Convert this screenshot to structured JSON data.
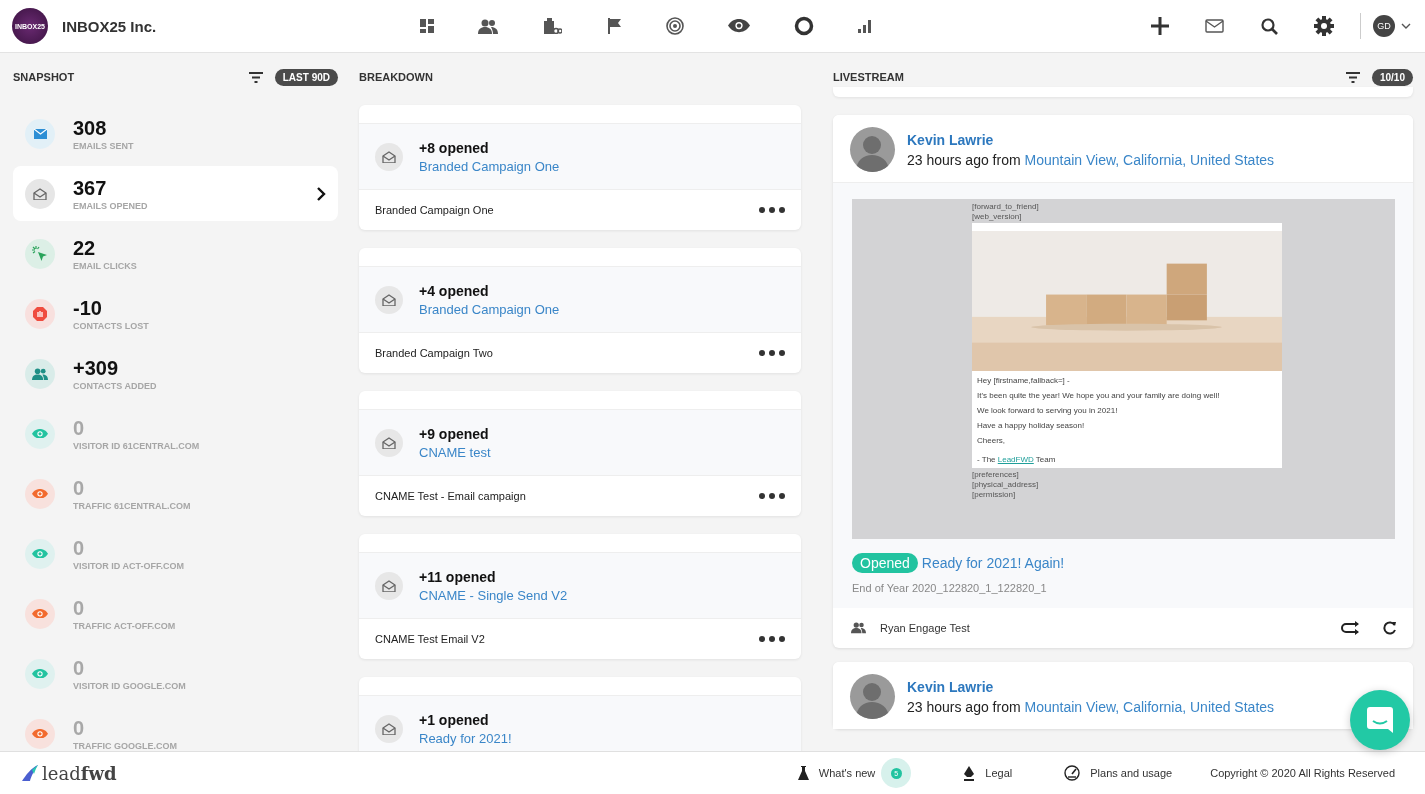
{
  "app": {
    "logo_text": "INBOX25",
    "company": "INBOX25 Inc.",
    "user_initials": "GD"
  },
  "snapshot": {
    "title": "SNAPSHOT",
    "badge": "LAST 90D",
    "stats": [
      {
        "kind": "sent",
        "value": "308",
        "label": "EMAILS SENT",
        "selected": false,
        "dimmed": false
      },
      {
        "kind": "opened",
        "value": "367",
        "label": "EMAILS OPENED",
        "selected": true,
        "dimmed": false
      },
      {
        "kind": "clicks",
        "value": "22",
        "label": "EMAIL CLICKS",
        "selected": false,
        "dimmed": false
      },
      {
        "kind": "lost",
        "value": "-10",
        "label": "CONTACTS LOST",
        "selected": false,
        "dimmed": false
      },
      {
        "kind": "added",
        "value": "+309",
        "label": "CONTACTS ADDED",
        "selected": false,
        "dimmed": false
      },
      {
        "kind": "visitor",
        "value": "0",
        "label": "VISITOR ID 61CENTRAL.COM",
        "selected": false,
        "dimmed": true
      },
      {
        "kind": "traffic",
        "value": "0",
        "label": "TRAFFIC 61CENTRAL.COM",
        "selected": false,
        "dimmed": true
      },
      {
        "kind": "visitor",
        "value": "0",
        "label": "VISITOR ID ACT-OFF.COM",
        "selected": false,
        "dimmed": true
      },
      {
        "kind": "traffic",
        "value": "0",
        "label": "TRAFFIC ACT-OFF.COM",
        "selected": false,
        "dimmed": true
      },
      {
        "kind": "visitor",
        "value": "0",
        "label": "VISITOR ID GOOGLE.COM",
        "selected": false,
        "dimmed": true
      },
      {
        "kind": "traffic",
        "value": "0",
        "label": "TRAFFIC GOOGLE.COM",
        "selected": false,
        "dimmed": true
      }
    ]
  },
  "breakdown": {
    "title": "BREAKDOWN",
    "cards": [
      {
        "count": "+8 opened",
        "campaign": "Branded Campaign One",
        "name": "Branded Campaign One"
      },
      {
        "count": "+4 opened",
        "campaign": "Branded Campaign One",
        "name": "Branded Campaign Two"
      },
      {
        "count": "+9 opened",
        "campaign": "CNAME test",
        "name": "CNAME Test - Email campaign"
      },
      {
        "count": "+11 opened",
        "campaign": "CNAME - Single Send V2",
        "name": "CNAME Test Email V2"
      },
      {
        "count": "+1 opened",
        "campaign": "Ready for 2021!"
      }
    ]
  },
  "livestream": {
    "title": "LIVESTREAM",
    "badge": "10/10",
    "events": [
      {
        "name": "Kevin Lawrie",
        "time": "23 hours ago from",
        "location": "Mountain View, California, United States",
        "preview": {
          "header_lines": [
            "[forward_to_friend]",
            "[web_version]"
          ],
          "body_lines": [
            "Hey [firstname,fallback=] -",
            "It's been quite the year! We hope you and your family are doing well!",
            "We look forward to serving you in 2021!",
            "Have a happy holiday season!",
            "Cheers,"
          ],
          "sign_prefix": "- The",
          "sign_link": "LeadFWD",
          "sign_suffix": "Team",
          "footer_lines": [
            "[preferences]",
            "[physical_address]",
            "[permission]"
          ]
        },
        "status": "Opened",
        "subject": "Ready for 2021! Again!",
        "campaign_id": "End of Year 2020_122820_1_122820_1",
        "list": "Ryan Engage Test"
      },
      {
        "name": "Kevin Lawrie",
        "time": "23 hours ago from",
        "location": "Mountain View, California, United States"
      }
    ]
  },
  "footer": {
    "brand_light": "lead",
    "brand_bold": "fwd",
    "links": [
      {
        "kind": "news",
        "label": "What's new",
        "badge": "5"
      },
      {
        "kind": "legal",
        "label": "Legal"
      },
      {
        "kind": "plans",
        "label": "Plans and usage"
      }
    ],
    "copyright": "Copyright © 2020 All Rights Reserved"
  }
}
